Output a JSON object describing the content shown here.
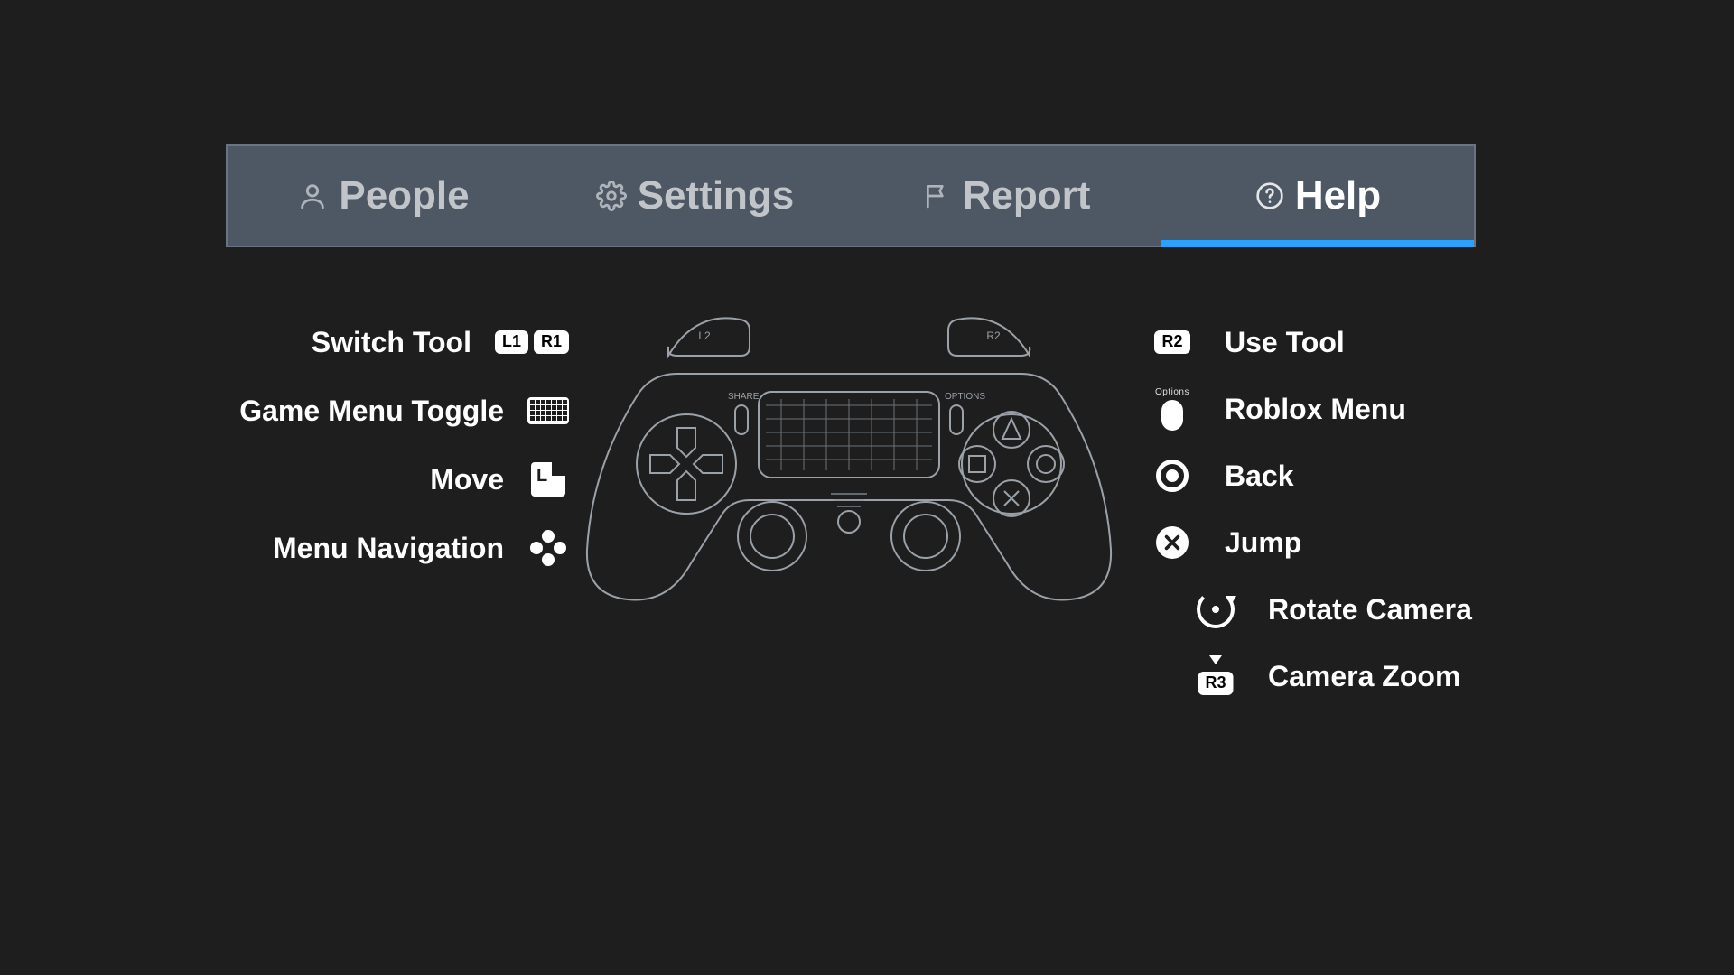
{
  "tabbar": {
    "tabs": [
      {
        "label": "People"
      },
      {
        "label": "Settings"
      },
      {
        "label": "Report"
      },
      {
        "label": "Help"
      }
    ],
    "active_index": 3
  },
  "help": {
    "left": {
      "switch_tool": {
        "label": "Switch Tool",
        "glyph_l1": "L1",
        "glyph_r1": "R1"
      },
      "game_menu_toggle": {
        "label": "Game Menu Toggle"
      },
      "move": {
        "label": "Move"
      },
      "menu_navigation": {
        "label": "Menu Navigation"
      }
    },
    "right": {
      "use_tool": {
        "label": "Use Tool",
        "glyph_r2": "R2"
      },
      "roblox_menu": {
        "label": "Roblox Menu",
        "options_label": "Options"
      },
      "back": {
        "label": "Back"
      },
      "jump": {
        "label": "Jump"
      },
      "rotate_camera": {
        "label": "Rotate Camera"
      },
      "camera_zoom": {
        "label": "Camera Zoom",
        "glyph_r3": "R3"
      }
    }
  },
  "controller": {
    "share_label": "SHARE",
    "options_label": "OPTIONS",
    "trigger_l2": "L2",
    "trigger_r2": "R2"
  }
}
